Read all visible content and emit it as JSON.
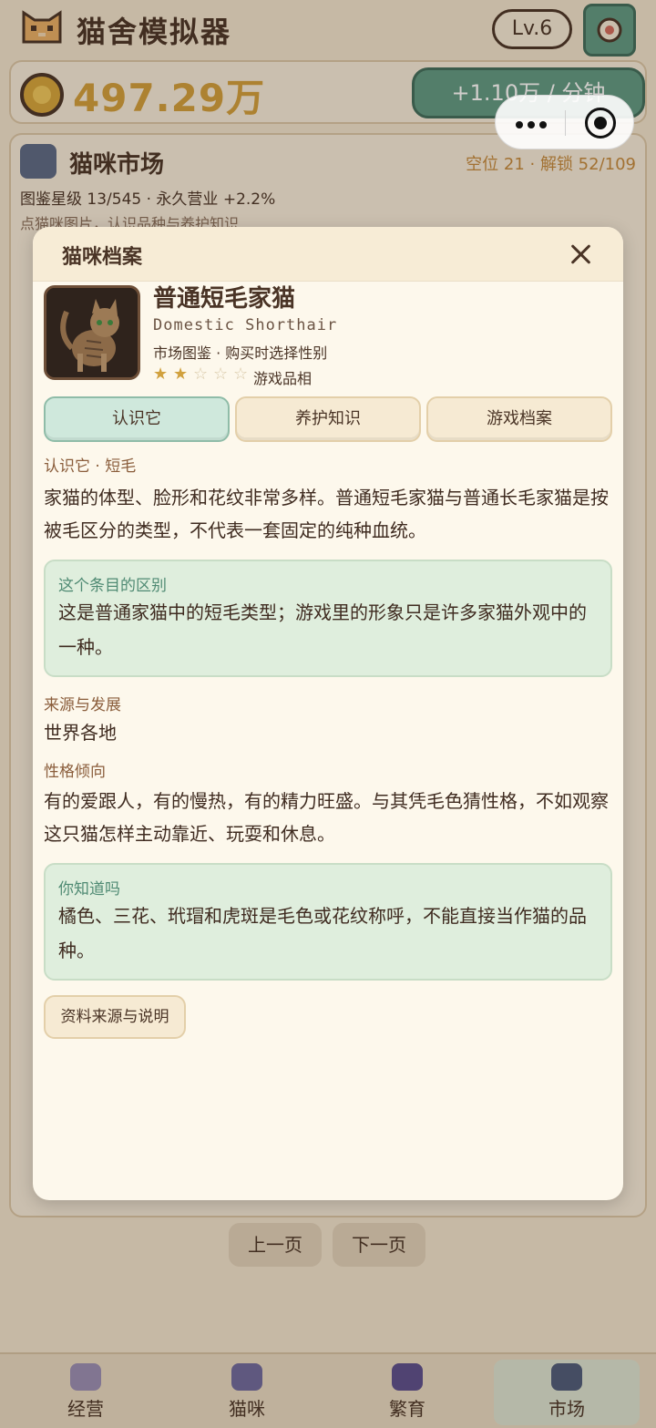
{
  "header": {
    "app_title": "猫舍模拟器",
    "level": "Lv.6"
  },
  "resources": {
    "coins": "497.29万",
    "rate": "+1.10万 / 分钟"
  },
  "market": {
    "title": "猫咪市场",
    "slots": "空位 21 · 解锁 52/109",
    "stats": "图鉴星级 13/545 · 永久营业 +2.2%",
    "hint": "点猫咪图片，认识品种与养护知识"
  },
  "pagination": {
    "prev": "上一页",
    "next": "下一页"
  },
  "bottom_nav": [
    {
      "label": "经营",
      "icon": "house-icon"
    },
    {
      "label": "猫咪",
      "icon": "cat-icon"
    },
    {
      "label": "繁育",
      "icon": "heart-icon"
    },
    {
      "label": "市场",
      "icon": "shop-icon"
    }
  ],
  "modal": {
    "title": "猫咪档案",
    "cat": {
      "name": "普通短毛家猫",
      "en_name": "Domestic Shorthair",
      "meta": "市场图鉴 · 购买时选择性别",
      "rating": 2,
      "rating_max": 5,
      "rating_label": "游戏品相"
    },
    "tabs": [
      "认识它",
      "养护知识",
      "游戏档案"
    ],
    "active_tab": 0,
    "sections": {
      "intro_label": "认识它 · 短毛",
      "intro_text": "家猫的体型、脸形和花纹非常多样。普通短毛家猫与普通长毛家猫是按被毛区分的类型，不代表一套固定的纯种血统。",
      "diff_label": "这个条目的区别",
      "diff_text": "这是普通家猫中的短毛类型；游戏里的形象只是许多家猫外观中的一种。",
      "origin_label": "来源与发展",
      "origin_text": "世界各地",
      "temper_label": "性格倾向",
      "temper_text": "有的爱跟人，有的慢热，有的精力旺盛。与其凭毛色猜性格，不如观察这只猫怎样主动靠近、玩耍和休息。",
      "fact_label": "你知道吗",
      "fact_text": "橘色、三花、玳瑁和虎斑是毛色或花纹称呼，不能直接当作猫的品种。"
    },
    "source_button": "资料来源与说明"
  },
  "colors": {
    "accent_green": "#5f9a83",
    "gold": "#d39f3a",
    "brown": "#4a3426"
  }
}
